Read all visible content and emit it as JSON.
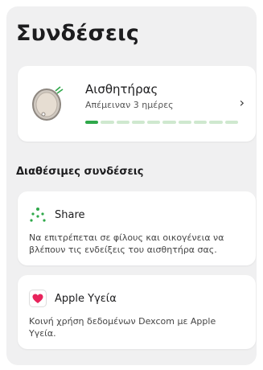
{
  "title": "Συνδέσεις",
  "sensor": {
    "name": "Αισθητήρας",
    "remaining": "Απέμειναν 3 ημέρες",
    "progress_segments_total": 10,
    "progress_segments_filled": 1,
    "accent": "#2fa84a",
    "track": "#cfe8cf",
    "chevron": "›"
  },
  "available": {
    "title": "Διαθέσιμες συνδέσεις",
    "items": [
      {
        "icon": "share-icon",
        "name": "Share",
        "description": "Να επιτρέπεται σε φίλους και οικογένεια να βλέπουν τις ενδείξεις του αισθητήρα σας."
      },
      {
        "icon": "heart-icon",
        "name": "Apple Υγεία",
        "description": "Κοινή χρήση δεδομένων Dexcom με Apple Υγεία."
      }
    ]
  },
  "colors": {
    "background": "#ffffff",
    "panel": "#f0f0f1",
    "heart": "#e8245c",
    "share_dots": "#2fa84a"
  }
}
